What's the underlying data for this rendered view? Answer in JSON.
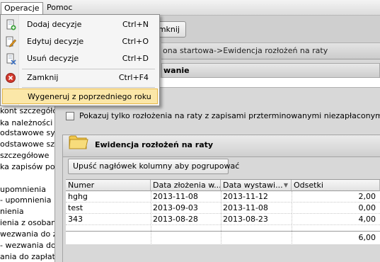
{
  "menubar": {
    "items": [
      {
        "label": "Operacje"
      },
      {
        "label": "Pomoc"
      }
    ]
  },
  "dropdown": {
    "items": [
      {
        "label": "Dodaj decyzje",
        "shortcut": "Ctrl+N",
        "icon": "add-document-icon"
      },
      {
        "label": "Edytuj decyzje",
        "shortcut": "Ctrl+O",
        "icon": "edit-document-icon"
      },
      {
        "label": "Usuń decyzje",
        "shortcut": "Ctrl+D",
        "icon": "delete-document-icon"
      },
      {
        "label": "Zamknij",
        "shortcut": "Ctrl+F4",
        "icon": "close-red-icon"
      },
      {
        "label": "Wygeneruj z poprzedniego roku",
        "shortcut": "",
        "icon": ""
      }
    ]
  },
  "toolbar": {
    "close_label": "Zamknij"
  },
  "breadcrumb": {
    "text": "ona startowa->Ewidencja rozłożeń na raty"
  },
  "section": {
    "title": "wanie"
  },
  "left_nav": {
    "items": [
      "kont szczegółow",
      "ka należności",
      "odstawowe syr",
      "odstawowe szc",
      "szczegółowe",
      "ka zapisów poda",
      "",
      "upomnienia",
      "- upomnienia",
      "nienia",
      "ienia z osobami",
      "wezwania do zapł",
      "- wezwania do z",
      "ania do zapłaty"
    ]
  },
  "filter": {
    "checkbox_label": "Pokazuj tylko rozłożenia na raty z zapisami przterminowanymi niezapłaconymi",
    "checked": false
  },
  "group": {
    "title": "Ewidencja rozłożeń na raty"
  },
  "grid": {
    "group_by_hint": "Upuść nagłówek kolumny aby pogrupować",
    "columns": [
      "Numer",
      "Data złożenia w...",
      "Data wystawi...",
      "Odsetki"
    ],
    "rows": [
      {
        "numer": "hghg",
        "data_zlozenia": "2013-11-08",
        "data_wystawienia": "2013-11-12",
        "odsetki": "2,00"
      },
      {
        "numer": "test",
        "data_zlozenia": "2013-09-03",
        "data_wystawienia": "2013-11-08",
        "odsetki": "0,00"
      },
      {
        "numer": "343",
        "data_zlozenia": "2013-08-28",
        "data_wystawienia": "2013-08-23",
        "odsetki": "4,00"
      }
    ],
    "summary": {
      "odsetki": "6,00"
    }
  },
  "colors": {
    "highlight": "#fbe7a8",
    "highlight_border": "#e6b84a"
  }
}
